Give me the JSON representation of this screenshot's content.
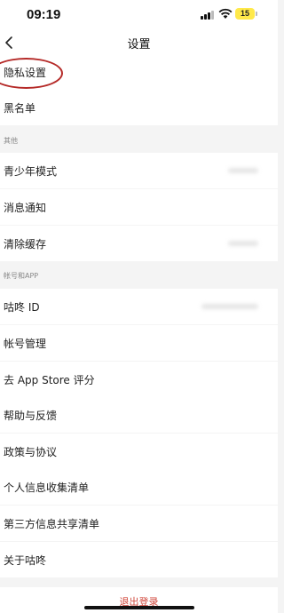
{
  "status_bar": {
    "time": "09:19",
    "battery": "15"
  },
  "nav": {
    "title": "设置"
  },
  "rows": [
    {
      "label": "隐私设置"
    },
    {
      "label": "黑名单"
    },
    {
      "section": "其他"
    },
    {
      "label": "青少年模式"
    },
    {
      "label": "消息通知"
    },
    {
      "label": "清除缓存"
    },
    {
      "section": "帐号和APP"
    },
    {
      "label": "咕咚 ID"
    },
    {
      "label": "帐号管理"
    },
    {
      "label": "去 App Store 评分"
    },
    {
      "label": "帮助与反馈"
    },
    {
      "label": "政策与协议"
    },
    {
      "label": "个人信息收集清单"
    },
    {
      "label": "第三方信息共享清单"
    },
    {
      "label": "关于咕咚"
    }
  ],
  "logout": {
    "label": "退出登录"
  },
  "colors": {
    "annotation_circle": "#b52a28",
    "logout_text": "#d0463a",
    "battery": "#ffe94a"
  }
}
